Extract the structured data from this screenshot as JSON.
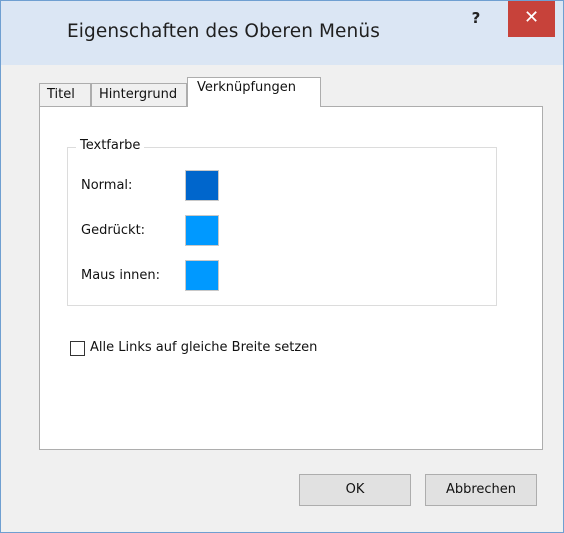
{
  "window": {
    "title": "Eigenschaften des Oberen Menüs",
    "help_label": "?",
    "close_label": "✕"
  },
  "tabs": [
    {
      "label": "Titel",
      "active": false
    },
    {
      "label": "Hintergrund",
      "active": false
    },
    {
      "label": "Verknüpfungen",
      "active": true
    }
  ],
  "links_tab": {
    "group_title": "Textfarbe",
    "colors": [
      {
        "label": "Normal:",
        "color": "#0066cc"
      },
      {
        "label": "Gedrückt:",
        "color": "#0099ff"
      },
      {
        "label": "Maus innen:",
        "color": "#0099ff"
      }
    ],
    "equal_width_checkbox": {
      "label": "Alle Links auf gleiche Breite setzen",
      "checked": false
    }
  },
  "buttons": {
    "ok": "OK",
    "cancel": "Abbrechen"
  }
}
